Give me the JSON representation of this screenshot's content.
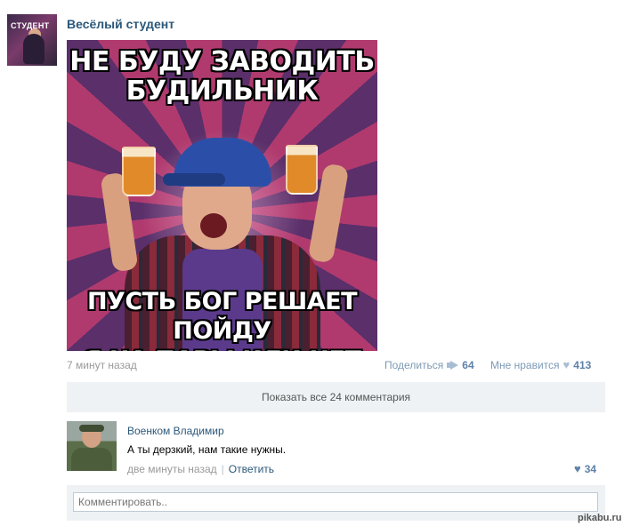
{
  "post": {
    "group_name": "Весёлый студент",
    "avatar_text": "СТУДЕНТ",
    "meme_top_text": "НЕ БУДУ ЗАВОДИТЬ\nБУДИЛЬНИК",
    "meme_bottom_text": "ПУСТЬ БОГ РЕШАЕТ ПОЙДУ\nЯ НА ПАРЫ ИЛИ НЕТ",
    "time": "7 минут назад",
    "share_label": "Поделиться",
    "share_count": "64",
    "like_label": "Мне нравится",
    "like_count": "413",
    "show_comments_label": "Показать все 24 комментария"
  },
  "comment": {
    "author": "Военком Владимир",
    "text": "А ты дерзкий, нам такие нужны.",
    "time": "две минуты назад",
    "separator": "|",
    "reply_label": "Ответить",
    "like_count": "34"
  },
  "comment_box": {
    "placeholder": "Комментировать.."
  },
  "watermark": "pikabu.ru",
  "icons": {
    "share": "megaphone-icon",
    "like": "heart-icon"
  },
  "colors": {
    "link": "#2b587a",
    "muted": "#999999",
    "action": "#7d9ab5",
    "bar_bg": "#eef2f5"
  }
}
